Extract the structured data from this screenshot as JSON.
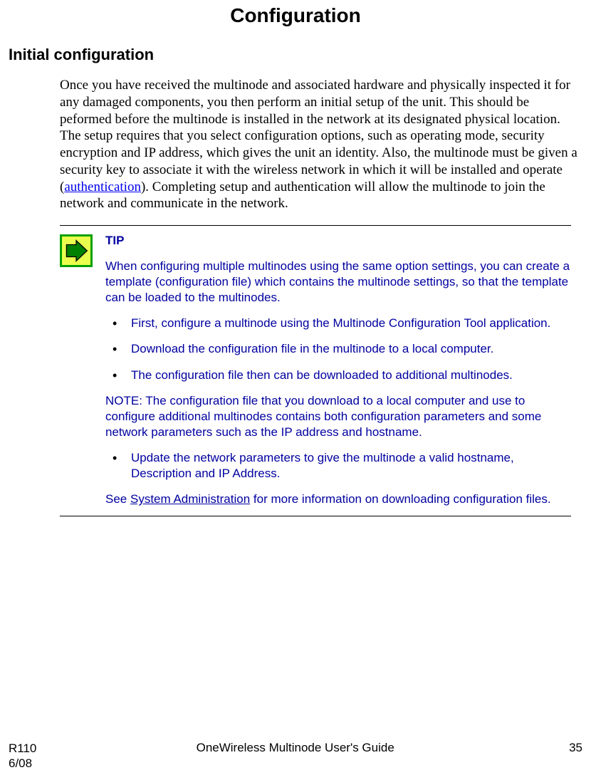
{
  "title": "Configuration",
  "section_heading": "Initial configuration",
  "intro": {
    "before_link": "Once you have received the multinode and associated hardware and physically inspected it for any damaged components, you then perform an initial setup of the unit.  This should be peformed before the multinode is installed in the network at its designated physical location. The setup requires that you select configuration options, such as operating mode, security encryption and IP address, which gives the unit an identity.  Also, the multinode must be given a security key to associate it with the wireless network in which it will be installed and operate (",
    "link_text": "authentication",
    "after_link": ").  Completing setup and authentication will allow the multinode to join the network and communicate in the network."
  },
  "tip": {
    "label": "TIP",
    "intro": "When configuring multiple multinodes using the same option settings, you can create a template (configuration file) which contains the multinode settings, so that the template can be loaded to the multinodes.",
    "bullets_first": [
      "First, configure a multinode using the Multinode Configuration Tool application.",
      "Download the configuration file in the multinode to a local computer.",
      "The configuration file then can be downloaded to additional multinodes."
    ],
    "note": "NOTE:  The configuration file that you download to a local computer and use to configure additional multinodes contains both configuration parameters and some network parameters such as the IP address and hostname.",
    "bullets_second": [
      "Update the network parameters to give the multinode a valid hostname, Description and IP Address."
    ],
    "see_prefix": "See ",
    "see_link": "System Administration",
    "see_suffix": " for more information on downloading configuration files."
  },
  "footer": {
    "left_line1": "R110",
    "left_line2": "6/08",
    "center": "OneWireless Multinode User's Guide",
    "right": "35"
  }
}
